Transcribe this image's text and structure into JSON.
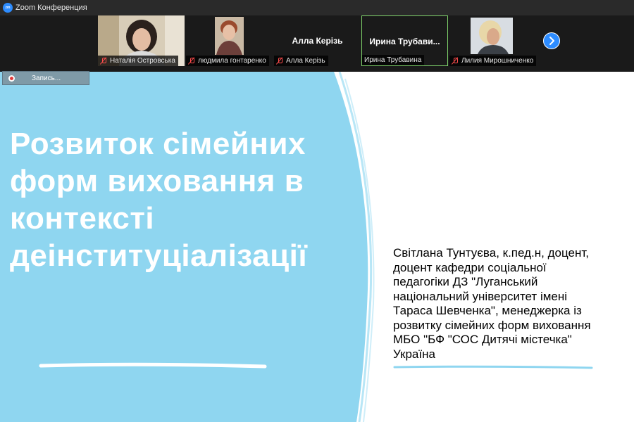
{
  "window": {
    "title": "Zoom Конференция",
    "app_icon_text": "zm"
  },
  "participants": [
    {
      "name": "Наталія Островська",
      "muted": true,
      "video": true
    },
    {
      "name": "людмила гонтаренко",
      "muted": true,
      "video": true
    },
    {
      "name": "Алла Керізь",
      "display_name": "Алла Керізь",
      "muted": true,
      "video": false
    },
    {
      "name": "Ирина Трубавина",
      "display_name": "Ирина Трубави...",
      "muted": false,
      "video": false,
      "speaking": true
    },
    {
      "name": "Лилия Мирошниченко",
      "muted": true,
      "video": true
    }
  ],
  "recording": {
    "label": "Запись..."
  },
  "slide": {
    "title_lines": [
      "Розвиток сімейних",
      "форм виховання в",
      "контексті",
      "деінституціалізації"
    ],
    "author_lines": [
      "Світлана Тунтуєва, к.пед.н, доцент,",
      "доцент кафедри соціальної",
      "педагогіки ДЗ \"Луганський",
      "національний університет імені",
      "Тараса Шевченка\", менеджерка із",
      "розвитку сімейних форм виховання",
      "МБО \"БФ \"СОС Дитячі містечка\"",
      "Україна"
    ],
    "colors": {
      "blob": "#8fd6f0",
      "title": "#ffffff",
      "background": "#ffffff"
    }
  },
  "colors": {
    "titlebar": "#2a2a2a",
    "strip": "#1a1a1a",
    "accent": "#2d8cff",
    "speaking_border": "#7fd36b",
    "muted": "#ff4d4d"
  }
}
